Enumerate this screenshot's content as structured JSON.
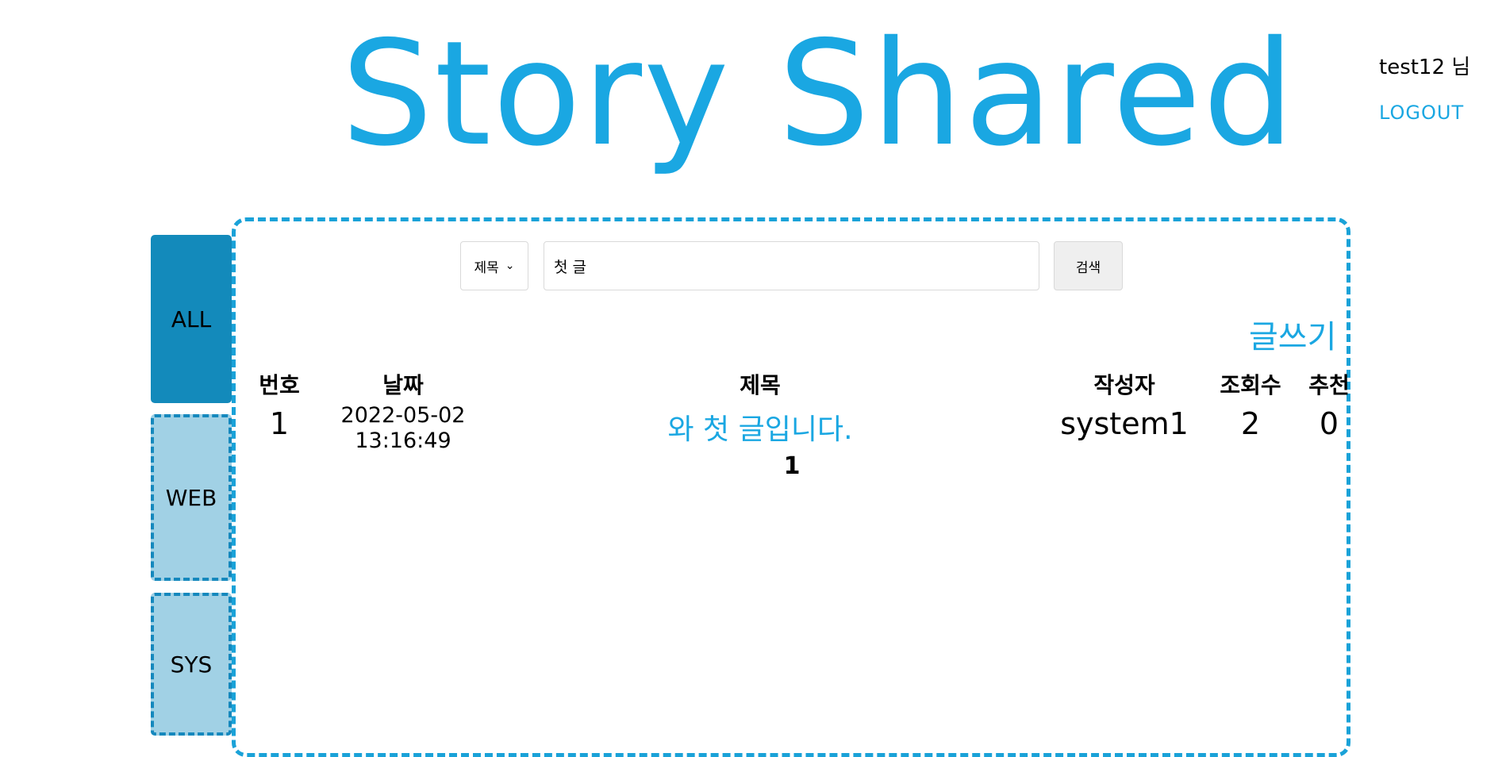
{
  "header": {
    "site_title": "Story Shared",
    "user_name": "test12 님",
    "logout_label": "LOGOUT"
  },
  "sidebar": {
    "tabs": [
      {
        "label": "ALL",
        "active": true
      },
      {
        "label": "WEB",
        "active": false
      },
      {
        "label": "SYS",
        "active": false
      }
    ]
  },
  "search": {
    "field_option": "제목",
    "query": "첫 글",
    "button_label": "검색"
  },
  "board": {
    "write_label": "글쓰기",
    "columns": [
      "번호",
      "날짜",
      "제목",
      "작성자",
      "조회수",
      "추천"
    ],
    "rows": [
      {
        "number": "1",
        "date": "2022-05-02",
        "time": "13:16:49",
        "title": "와 첫 글입니다.",
        "author": "system1",
        "views": "2",
        "likes": "0"
      }
    ]
  },
  "pagination": {
    "pages": [
      "1"
    ]
  },
  "colors": {
    "accent": "#1aa7e2",
    "active_tab": "#138abb",
    "inactive_tab": "#a1d1e5",
    "dashed_border": "#1aa2d8"
  }
}
